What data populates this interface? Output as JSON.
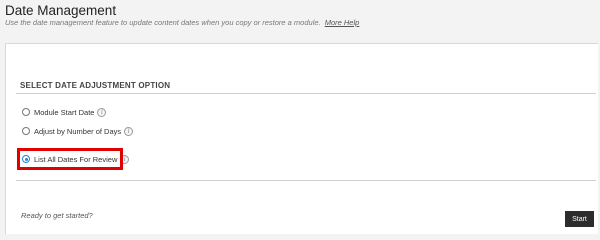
{
  "header": {
    "title": "Date Management",
    "subtitle": "Use the date management feature to update content dates when you copy or restore a module.",
    "help_link": "More Help"
  },
  "section": {
    "title": "SELECT DATE ADJUSTMENT OPTION"
  },
  "options": [
    {
      "label": "Module Start Date",
      "selected": false,
      "icon": "info-icon"
    },
    {
      "label": "Adjust by Number of Days",
      "selected": false,
      "icon": "info-icon"
    },
    {
      "label": "List All Dates For Review",
      "selected": true,
      "icon": "info-icon"
    }
  ],
  "footer": {
    "ready_text": "Ready to get started?",
    "start_label": "Start"
  },
  "colors": {
    "highlight": "#e00000",
    "radio_selected": "#2a7fd1",
    "button_bg": "#2c2c2c"
  }
}
